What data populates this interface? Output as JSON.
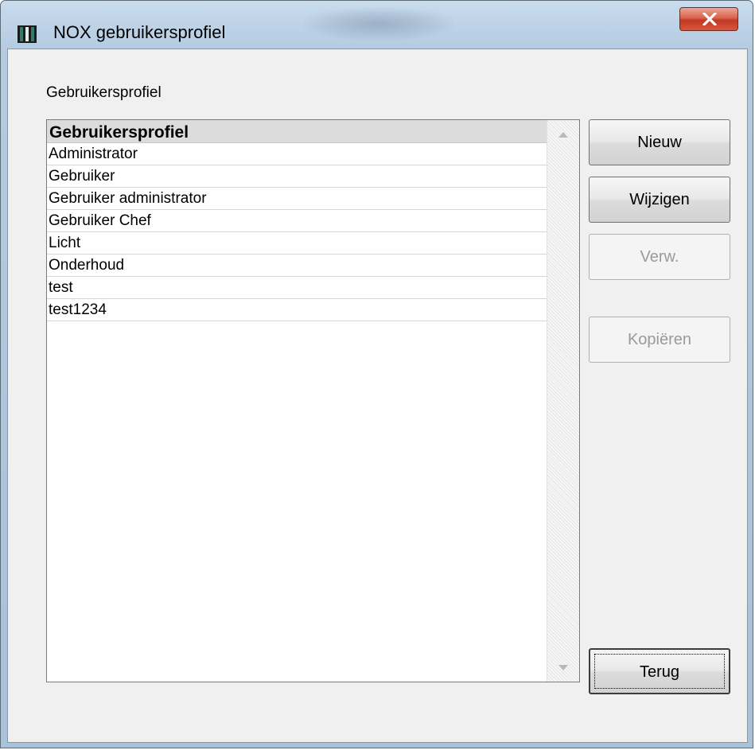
{
  "window": {
    "title": "NOX gebruikersprofiel",
    "close_icon": "close-x-icon",
    "app_icon": "nox-app-icon"
  },
  "group_label": "Gebruikersprofiel",
  "list": {
    "header": "Gebruikersprofiel",
    "items": [
      "Administrator",
      "Gebruiker",
      "Gebruiker administrator",
      "Gebruiker Chef",
      "Licht",
      "Onderhoud",
      "test",
      "test1234"
    ]
  },
  "buttons": {
    "new": "Nieuw",
    "edit": "Wijzigen",
    "delete": "Verw.",
    "copy": "Kopiëren",
    "back": "Terug"
  },
  "colors": {
    "close_button": "#c23a24",
    "title_bar": "#b4cbe1",
    "client_bg": "#f0f0f0"
  }
}
